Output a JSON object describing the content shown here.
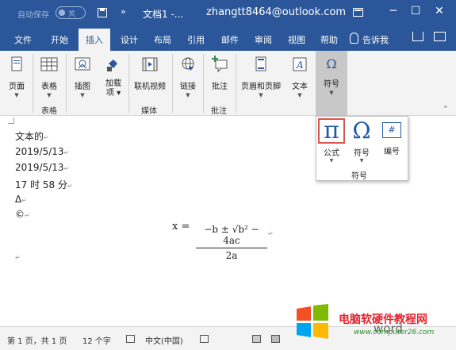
{
  "titlebar": {
    "autosave_label": "自动保存",
    "autosave_state": "关",
    "doc_title": "文档1 -...",
    "account": "zhangtt8464@outlook.com",
    "more": "»",
    "minimize": "─",
    "restore": "☐",
    "close": "✕"
  },
  "tabs": [
    "文件",
    "开始",
    "插入",
    "设计",
    "布局",
    "引用",
    "邮件",
    "审阅",
    "视图",
    "帮助"
  ],
  "active_tab": "插入",
  "tell_me": "告诉我",
  "ribbon": {
    "pages": "页面",
    "tables": "表格",
    "tables_group": "表格",
    "illustrations": "插图",
    "addins": "加载\n项",
    "online_video": "联机视频",
    "media_group": "媒体",
    "links": "链接",
    "comment": "批注",
    "comments_group": "批注",
    "header_footer": "页眉和页脚",
    "text": "文本",
    "symbols": "符号"
  },
  "document": {
    "lines": [
      "文本的",
      "2019/5/13",
      "2019/5/13",
      "17 时 58 分",
      "Δ",
      "©"
    ],
    "equation_lhs": "x =",
    "equation_num": "−b ± √b² − 4ac",
    "equation_den": "2a"
  },
  "symbol_panel": {
    "equation_label": "公式",
    "symbol_label": "符号",
    "number_label": "编号",
    "group_label": "符号",
    "pi": "π",
    "omega": "Ω",
    "number_glyph": "#"
  },
  "statusbar": {
    "page_info": "第 1 页，共 1 页",
    "word_count": "12 个字",
    "language": "中文(中国)"
  },
  "watermark": {
    "title": "电脑软硬件教程网",
    "url": "www.computer26.com",
    "word": "word"
  },
  "colors": {
    "accent": "#2b579a",
    "equation_icon": "#1e5aa8",
    "highlight_border": "#d9534f"
  }
}
